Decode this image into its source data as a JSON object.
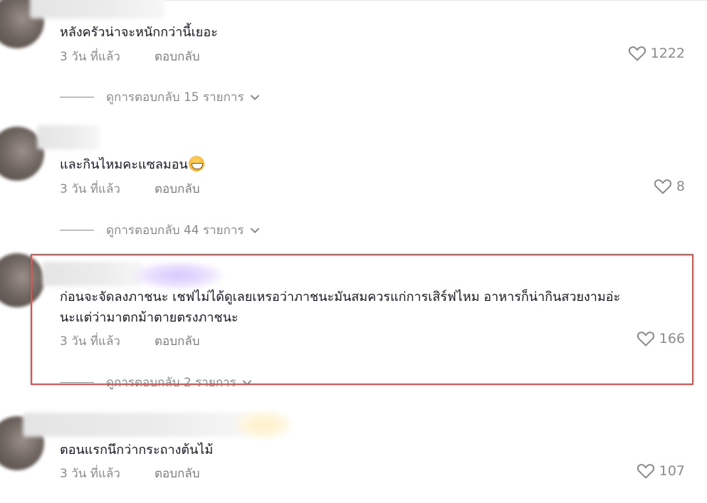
{
  "comments": [
    {
      "text": "หลังครัวน่าจะหนักกว่านี้เยอะ",
      "time": "3 วัน ที่แล้ว",
      "reply_label": "ตอบกลับ",
      "likes": "1222",
      "view_replies": "ดูการตอบกลับ 15 รายการ"
    },
    {
      "text": "และกินไหมคะแซลมอน",
      "emoji": "grinning-face-emoji",
      "time": "3 วัน ที่แล้ว",
      "reply_label": "ตอบกลับ",
      "likes": "8",
      "view_replies": "ดูการตอบกลับ 44 รายการ"
    },
    {
      "text_line1": "ก่อนจะจัดลงภาชนะ เชฟไม่ได้ดูเลยเหรอว่าภาชนะมันสมควรแก่การเสิร์ฟไหม อาหารก็น่ากินสวยงามอ่ะ",
      "text_line2": "นะแต่ว่ามาตกม้าตายตรงภาชนะ",
      "time": "3 วัน ที่แล้ว",
      "reply_label": "ตอบกลับ",
      "likes": "166",
      "view_replies": "ดูการตอบกลับ 2 รายการ",
      "highlighted": true
    },
    {
      "text": "ตอนแรกนึกว่ากระถางต้นไม้",
      "time": "3 วัน ที่แล้ว",
      "reply_label": "ตอบกลับ",
      "likes": "107"
    }
  ],
  "colors": {
    "text": "#161823",
    "muted": "#8a8b91",
    "highlight_border": "#e0524e"
  },
  "icons": {
    "like": "heart-outline-icon",
    "expand": "chevron-down-icon"
  }
}
